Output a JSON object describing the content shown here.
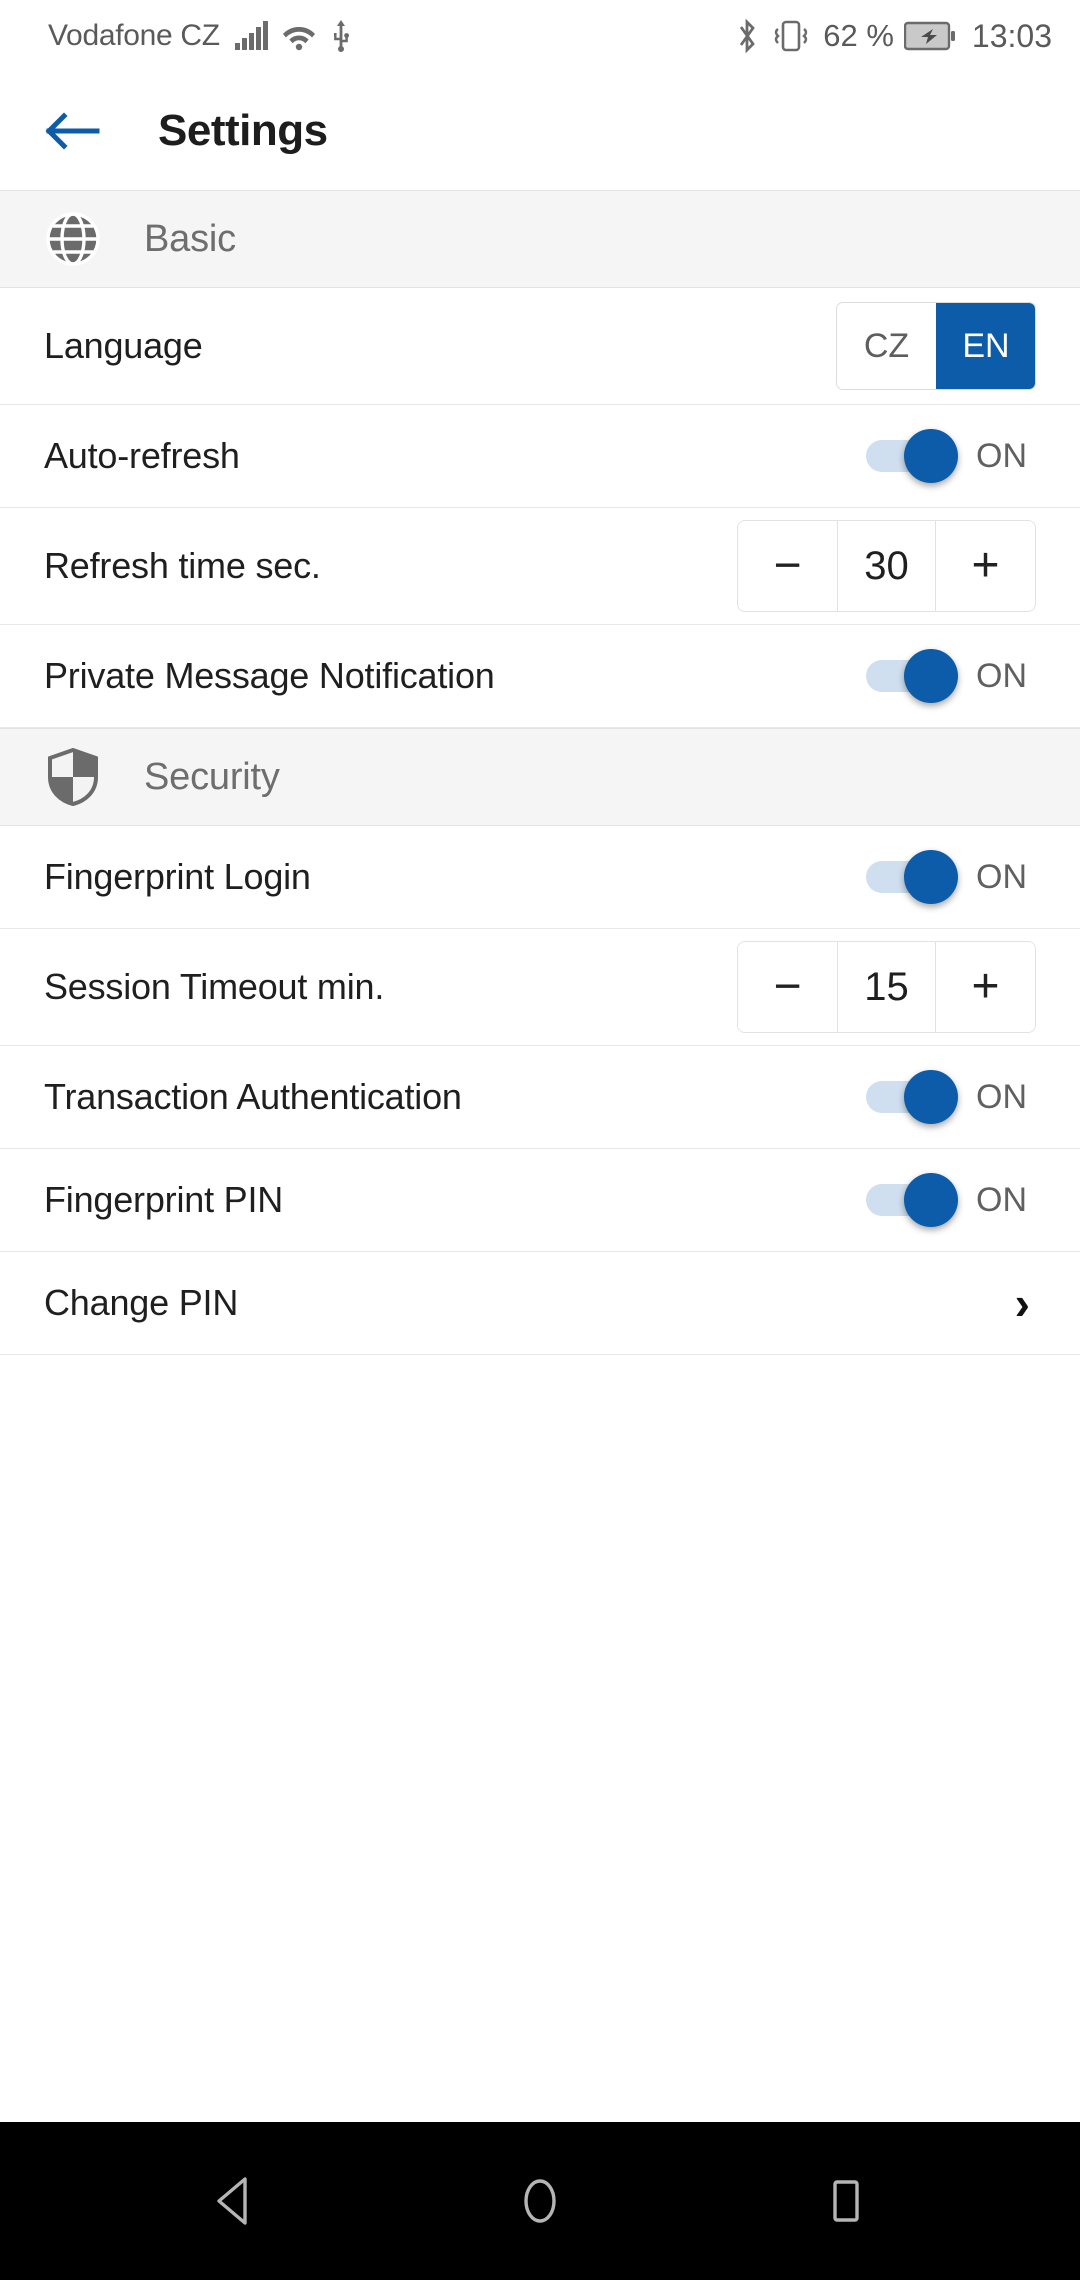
{
  "status_bar": {
    "carrier": "Vodafone CZ",
    "signal_icon": "cellular-signal-icon",
    "wifi_icon": "wifi-icon",
    "usb_icon": "usb-icon",
    "bluetooth_icon": "bluetooth-icon",
    "vibrate_icon": "vibrate-icon",
    "battery_percent": "62 %",
    "battery_icon": "battery-charging-icon",
    "time": "13:03"
  },
  "appbar": {
    "back_icon": "arrow-left-icon",
    "title": "Settings",
    "accent_color": "#0d5ca9"
  },
  "sections": [
    {
      "id": "basic",
      "icon": "globe-icon",
      "title": "Basic"
    },
    {
      "id": "security",
      "icon": "shield-icon",
      "title": "Security"
    }
  ],
  "basic_rows": {
    "language": {
      "label": "Language",
      "options": [
        "CZ",
        "EN"
      ],
      "selected": "EN"
    },
    "auto_refresh": {
      "label": "Auto-refresh",
      "state": "ON"
    },
    "refresh_time": {
      "label": "Refresh time sec.",
      "value": "30",
      "decrement": "−",
      "increment": "+"
    },
    "private_message_notification": {
      "label": "Private Message Notification",
      "state": "ON"
    }
  },
  "security_rows": {
    "fingerprint_login": {
      "label": "Fingerprint Login",
      "state": "ON"
    },
    "session_timeout": {
      "label": "Session Timeout min.",
      "value": "15",
      "decrement": "−",
      "increment": "+"
    },
    "transaction_authentication": {
      "label": "Transaction Authentication",
      "state": "ON"
    },
    "fingerprint_pin": {
      "label": "Fingerprint PIN",
      "state": "ON"
    },
    "change_pin": {
      "label": "Change PIN",
      "chevron": "›"
    }
  },
  "navbar": {
    "back_icon": "nav-back-triangle-icon",
    "home_icon": "nav-home-circle-icon",
    "recents_icon": "nav-recents-square-icon"
  },
  "colors": {
    "accent": "#0d5ca9",
    "section_bg": "#f5f5f5",
    "divider": "#e8e8e8",
    "text_primary": "#1f1f1f",
    "text_secondary": "#6e6e6e",
    "navbar_bg": "#000000"
  }
}
